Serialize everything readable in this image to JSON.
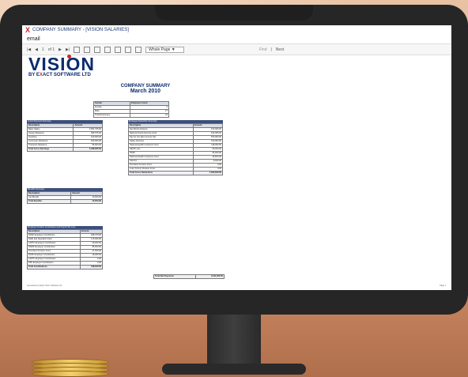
{
  "window": {
    "title": "COMPANY SUMMARY - [VISION SALARIES]"
  },
  "menu": {
    "label": "email"
  },
  "toolbar": {
    "first": "|◀",
    "prev": "◀",
    "page": "1",
    "of": "of 1",
    "next": "▶",
    "last": "▶|",
    "zoom": "Whole Page",
    "zoom_arrow": "▼",
    "find": "Find",
    "sep": "|",
    "next_label": "Next"
  },
  "logo": {
    "main_a": "VISI",
    "main_b": "N",
    "sub_a": "BY E",
    "sub_b": "X",
    "sub_c": "ACT SOFTWARE LTD"
  },
  "report": {
    "title": "COMPANY SUMMARY",
    "period": "March 2010"
  },
  "gender": {
    "headers": [
      "Gender",
      "Employee Count"
    ],
    "rows": [
      [
        "Female",
        "6"
      ],
      [
        "Male",
        "17"
      ],
      [
        "Total Employees",
        "23"
      ]
    ]
  },
  "gross": {
    "caption": "Gross Payment Summary",
    "headers": [
      "Description",
      "Amount"
    ],
    "rows": [
      [
        "Basic Salary",
        "3,051,795.00"
      ],
      [
        "House Allowance",
        "695,675.00"
      ],
      [
        "Overtime",
        "100,000.00"
      ],
      [
        "Commuter Allowance",
        "200,000.00"
      ],
      [
        "Transport Allowance",
        "55,000.00"
      ]
    ],
    "total": [
      "Total Gross Earnings",
      "4,498,065.00"
    ]
  },
  "deductions": {
    "caption": "Employee Deduction Summary",
    "headers": [
      "Description",
      "Amount"
    ],
    "rows": [
      [
        "Net Month Advance",
        "670,000.00"
      ],
      [
        "National Social Security Fund",
        "164,905.00"
      ],
      [
        "Pay As You Earn Income Tax",
        "870,000.00"
      ],
      [
        "Salary Advance",
        "100,000.00"
      ],
      [
        "National Health Insurance Fund",
        "118,362.50"
      ],
      [
        "HELB Loan",
        "60,000.00"
      ],
      [
        "NSSF",
        "66,000.00"
      ],
      [
        "National Health Insurance Fund",
        "29,600.00"
      ],
      [
        "SACCO",
        "8,000.00"
      ],
      [
        "Provident Pension Fund",
        "0.00"
      ],
      [
        "Loan (Union) Pension Fund",
        "0.00"
      ]
    ],
    "total": [
      "Total Gross Deductions",
      "1,500,000.00"
    ]
  },
  "benefits": {
    "caption": "Benefits Summary",
    "headers": [
      "Description",
      "Amount"
    ],
    "rows": [
      [
        "Car Benefit",
        "10,000.00"
      ]
    ],
    "total": [
      "Total Benefits",
      "10,000.00"
    ]
  },
  "employer": {
    "caption": "Employer Pension Contribution And Payroll Tax Levy",
    "headers": [
      "Description",
      "Amount"
    ],
    "rows": [
      [
        "NSSF Employer Contribution",
        "188,379.00"
      ],
      [
        "NHIF and Standard Chart",
        "170,000.00"
      ],
      [
        "LAPTF Employer Contribution",
        "29,362.50"
      ],
      [
        "NSMF Employer Contribution",
        "85,000.00"
      ],
      [
        "Provident Pension Fund",
        "47,000.00"
      ],
      [
        "NSSF Employer Contribution",
        "18,480.00"
      ],
      [
        "LAPTF Employer Contribution",
        "0.00"
      ],
      [
        "PPF Employer Contribution",
        "0.00"
      ]
    ],
    "total": [
      "Total Contributions",
      "738,810.50"
    ]
  },
  "net": {
    "label": "Total Net Payments",
    "value": "3,011,003.50"
  },
  "footer": {
    "left": "Generated by Exact Vision Software Ltd",
    "right": "Page 1"
  }
}
